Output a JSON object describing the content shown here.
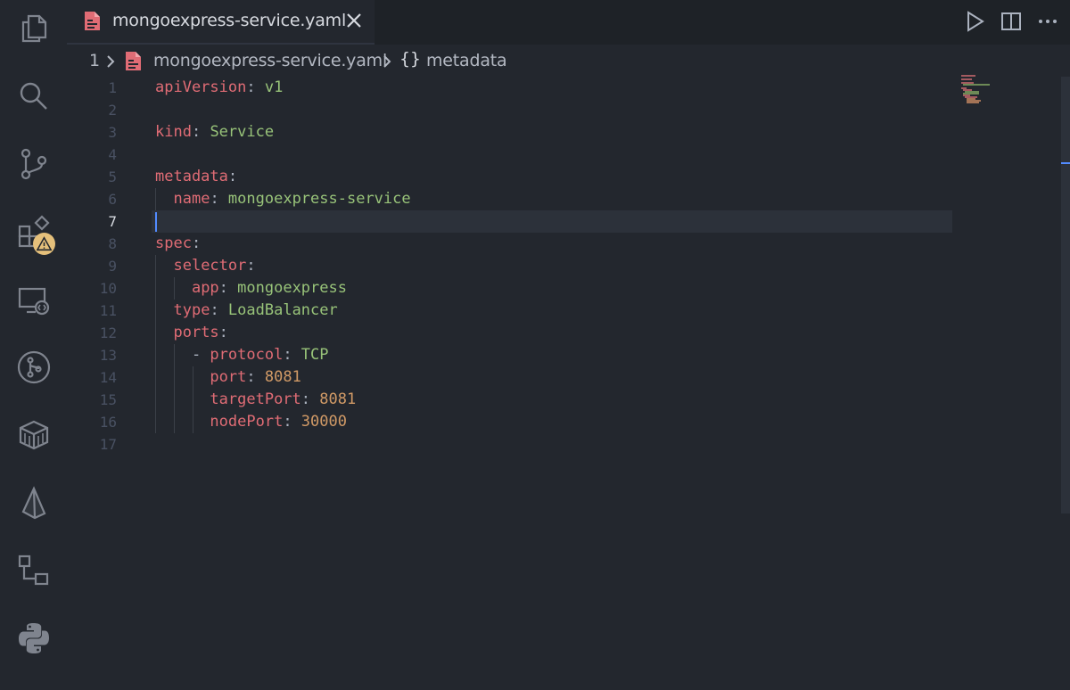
{
  "activity_bar": {
    "items": [
      {
        "icon": "files-icon"
      },
      {
        "icon": "search-icon"
      },
      {
        "icon": "source-control-icon"
      },
      {
        "icon": "extensions-icon",
        "badge": "warning"
      },
      {
        "icon": "remote-explorer-icon"
      },
      {
        "icon": "git-graph-icon"
      },
      {
        "icon": "docker-icon"
      },
      {
        "icon": "prisma-icon"
      },
      {
        "icon": "workflow-icon"
      },
      {
        "icon": "python-icon"
      }
    ]
  },
  "tab": {
    "label": "mongoexpress-service.yaml",
    "icon": "yaml-file-icon",
    "close_icon": "close-icon"
  },
  "editor_actions": [
    "run-icon",
    "split-editor-icon",
    "more-actions-icon"
  ],
  "breadcrumb": {
    "segment1": "1",
    "file": "mongoexpress-service.yaml",
    "symbol_icon": "{}",
    "symbol": "metadata"
  },
  "editor": {
    "active_line": 7,
    "lines": [
      {
        "n": "1",
        "tokens": [
          [
            "k",
            "apiVersion"
          ],
          [
            "p",
            ": "
          ],
          [
            "s",
            "v1"
          ]
        ]
      },
      {
        "n": "2",
        "tokens": []
      },
      {
        "n": "3",
        "tokens": [
          [
            "k",
            "kind"
          ],
          [
            "p",
            ": "
          ],
          [
            "s",
            "Service"
          ]
        ]
      },
      {
        "n": "4",
        "tokens": []
      },
      {
        "n": "5",
        "tokens": [
          [
            "k",
            "metadata"
          ],
          [
            "p",
            ":"
          ]
        ]
      },
      {
        "n": "6",
        "tokens": [
          [
            "p",
            "  "
          ],
          [
            "k",
            "name"
          ],
          [
            "p",
            ": "
          ],
          [
            "s",
            "mongoexpress-service"
          ]
        ]
      },
      {
        "n": "7",
        "tokens": []
      },
      {
        "n": "8",
        "tokens": [
          [
            "k",
            "spec"
          ],
          [
            "p",
            ":"
          ]
        ]
      },
      {
        "n": "9",
        "tokens": [
          [
            "p",
            "  "
          ],
          [
            "k",
            "selector"
          ],
          [
            "p",
            ":"
          ]
        ]
      },
      {
        "n": "10",
        "tokens": [
          [
            "p",
            "    "
          ],
          [
            "k",
            "app"
          ],
          [
            "p",
            ": "
          ],
          [
            "s",
            "mongoexpress"
          ]
        ]
      },
      {
        "n": "11",
        "tokens": [
          [
            "p",
            "  "
          ],
          [
            "k",
            "type"
          ],
          [
            "p",
            ": "
          ],
          [
            "s",
            "LoadBalancer"
          ]
        ]
      },
      {
        "n": "12",
        "tokens": [
          [
            "p",
            "  "
          ],
          [
            "k",
            "ports"
          ],
          [
            "p",
            ":"
          ]
        ]
      },
      {
        "n": "13",
        "tokens": [
          [
            "p",
            "    - "
          ],
          [
            "k",
            "protocol"
          ],
          [
            "p",
            ": "
          ],
          [
            "s",
            "TCP"
          ]
        ]
      },
      {
        "n": "14",
        "tokens": [
          [
            "p",
            "      "
          ],
          [
            "k",
            "port"
          ],
          [
            "p",
            ": "
          ],
          [
            "n",
            "8081"
          ]
        ]
      },
      {
        "n": "15",
        "tokens": [
          [
            "p",
            "      "
          ],
          [
            "k",
            "targetPort"
          ],
          [
            "p",
            ": "
          ],
          [
            "n",
            "8081"
          ]
        ]
      },
      {
        "n": "16",
        "tokens": [
          [
            "p",
            "      "
          ],
          [
            "k",
            "nodePort"
          ],
          [
            "p",
            ": "
          ],
          [
            "n",
            "30000"
          ]
        ]
      },
      {
        "n": "17",
        "tokens": []
      }
    ]
  },
  "colors": {
    "key": "#e06c75",
    "string": "#98c379",
    "number": "#d19a66",
    "punctuation": "#abb2bf",
    "cursor": "#528bff",
    "warning_badge": "#e5c07b"
  }
}
